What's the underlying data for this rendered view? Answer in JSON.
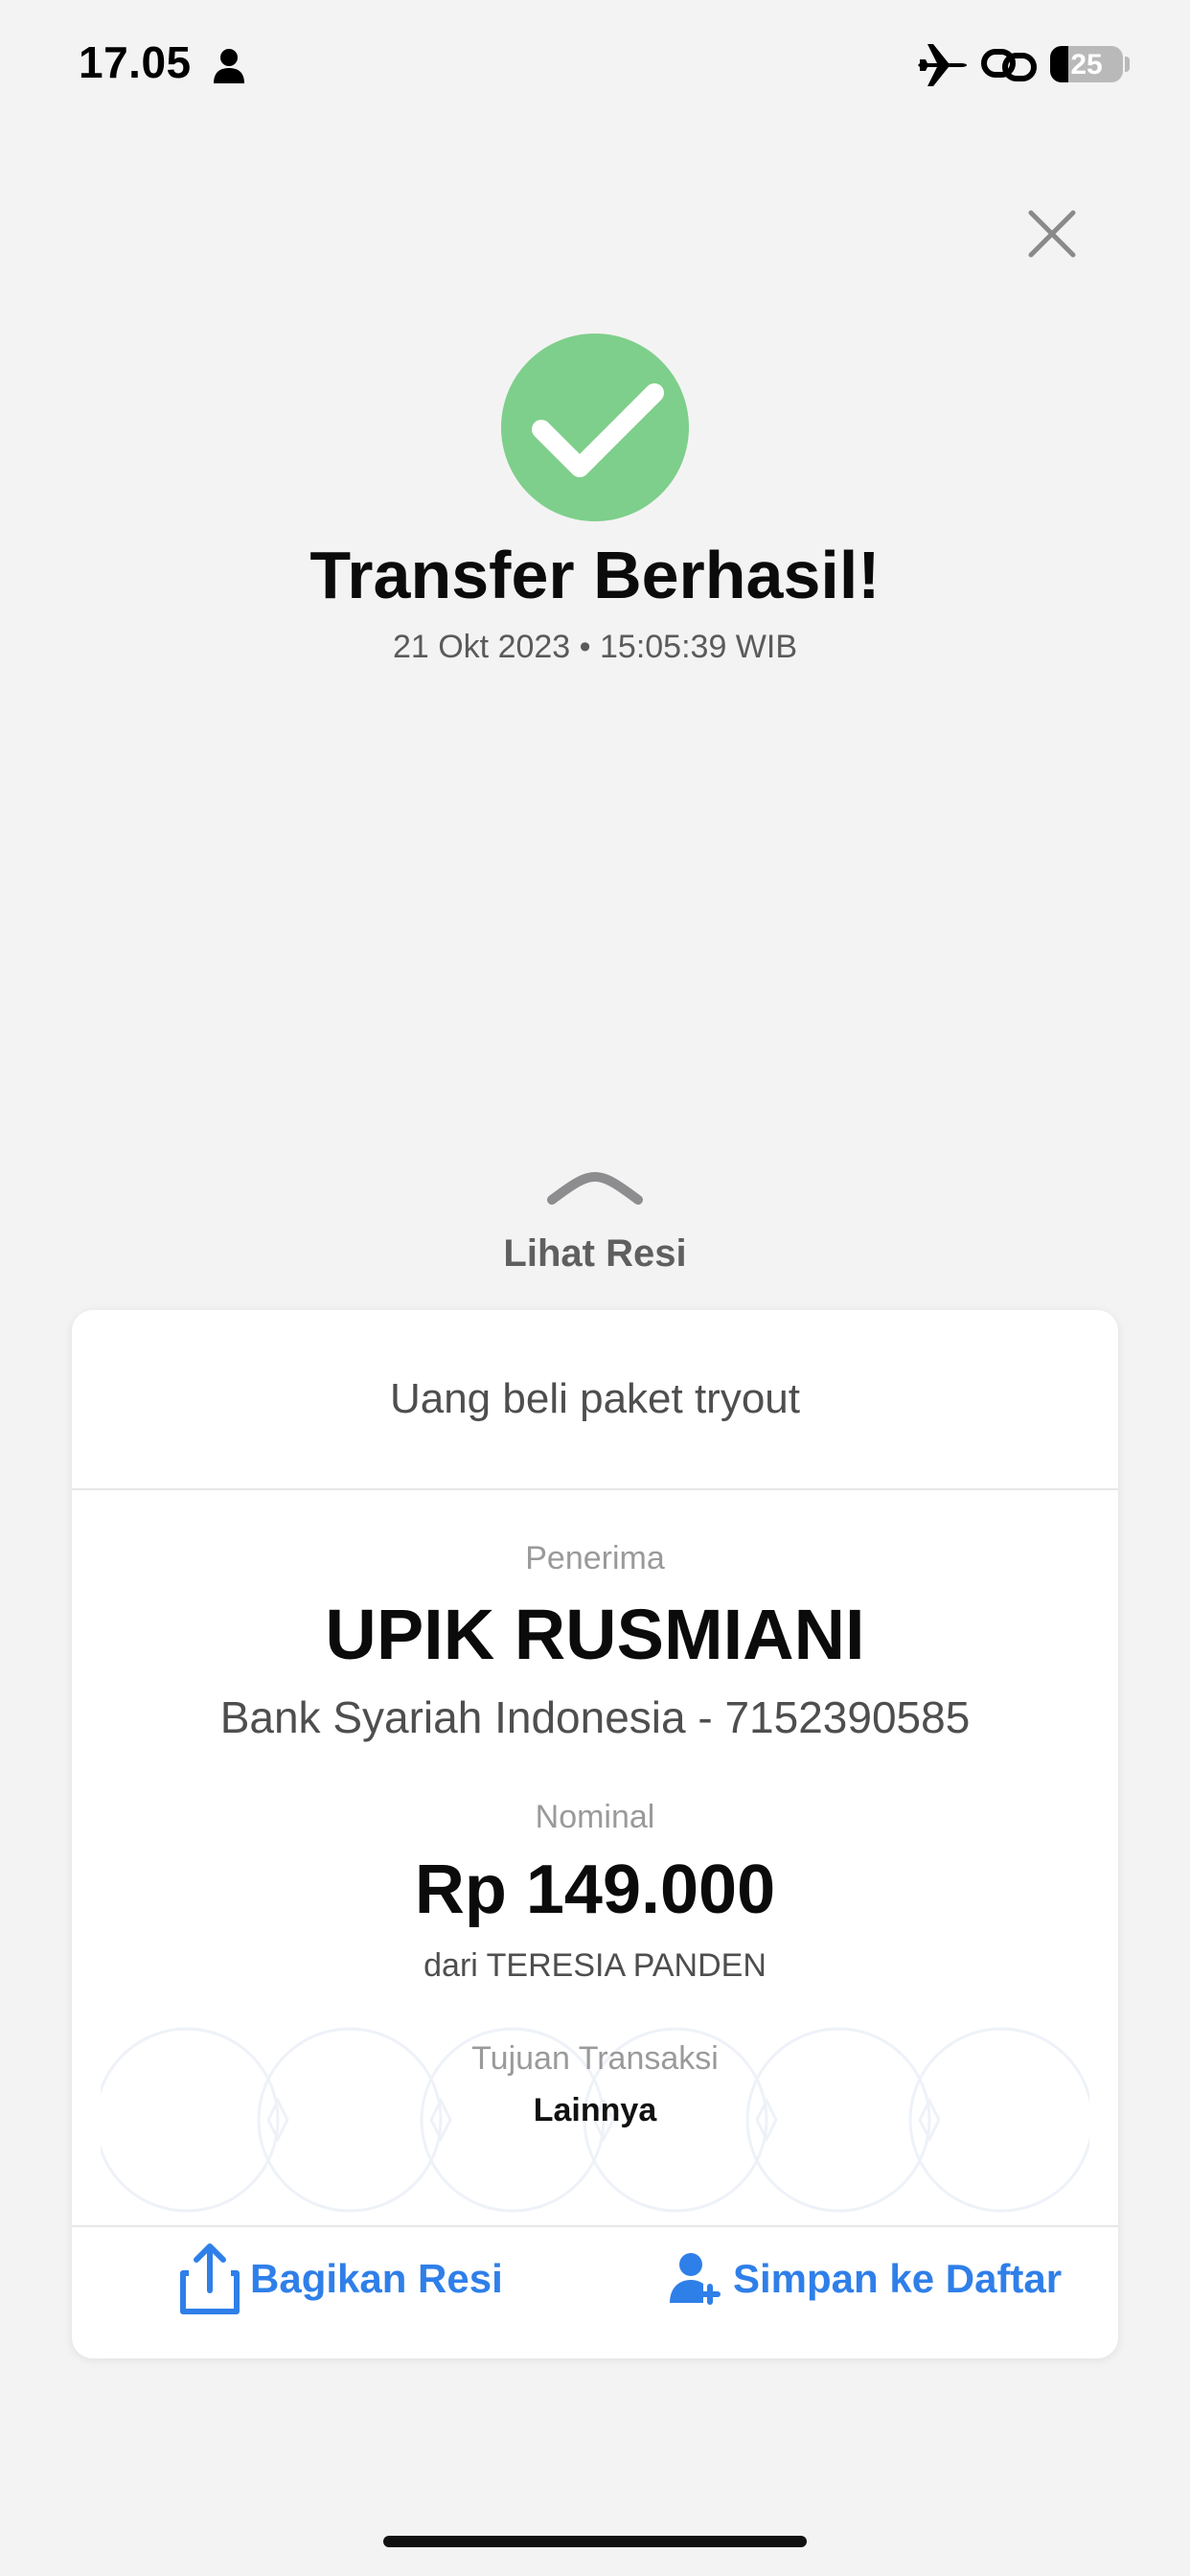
{
  "status_bar": {
    "time": "17.05",
    "battery_level": "25",
    "battery_fraction": 0.25
  },
  "header": {
    "title": "Transfer Berhasil!",
    "timestamp": "21 Okt 2023 • 15:05:39 WIB"
  },
  "receipt_toggle": {
    "label": "Lihat Resi"
  },
  "receipt": {
    "note": "Uang beli paket tryout",
    "recipient_label": "Penerima",
    "recipient_name": "UPIK RUSMIANI",
    "recipient_account": "Bank Syariah Indonesia - 7152390585",
    "amount_label": "Nominal",
    "amount": "Rp 149.000",
    "sender": "dari TERESIA PANDEN",
    "purpose_label": "Tujuan Transaksi",
    "purpose": "Lainnya"
  },
  "actions": {
    "share_label": "Bagikan Resi",
    "save_label": "Simpan ke Daftar"
  },
  "colors": {
    "background": "#f3f3f3",
    "success_green": "#7ecf8b",
    "accent_blue": "#2f7fe9",
    "card": "#ffffff"
  },
  "icons": [
    "person-icon",
    "airplane-icon",
    "link-icon",
    "battery-icon",
    "close-icon",
    "check-icon",
    "chevron-up-icon",
    "share-icon",
    "add-user-icon"
  ]
}
